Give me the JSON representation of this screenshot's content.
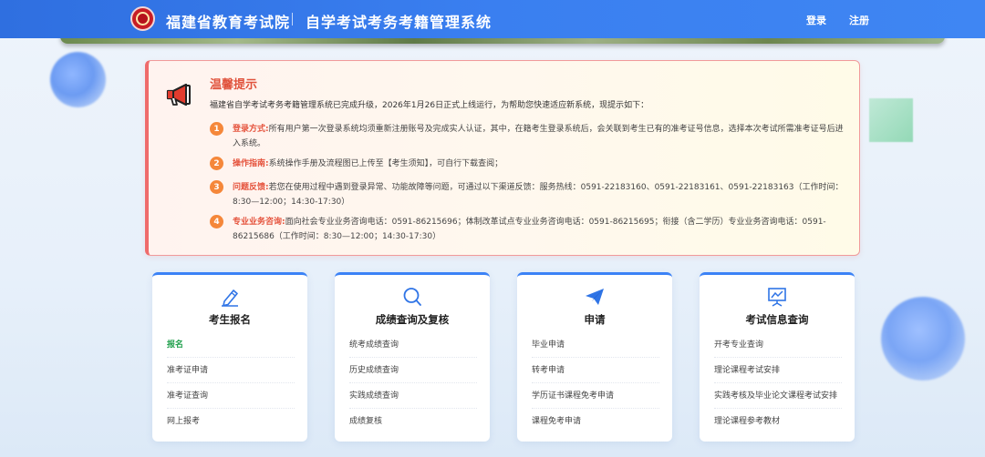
{
  "header": {
    "org_name": "福建省教育考试院",
    "system_name": "自学考试考务考籍管理系统",
    "login_label": "登录",
    "register_label": "注册"
  },
  "notice": {
    "title": "温馨提示",
    "intro": "福建省自学考试考务考籍管理系统已完成升级，2026年1月26日正式上线运行，为帮助您快速适应新系统，现提示如下：",
    "items": [
      {
        "num": "1",
        "label": "登录方式:",
        "text": "所有用户第一次登录系统均须重新注册账号及完成实人认证，其中，在籍考生登录系统后，会关联到考生已有的准考证号信息，选择本次考试所需准考证号后进入系统。"
      },
      {
        "num": "2",
        "label": "操作指南:",
        "text": "系统操作手册及流程图已上传至【考生须知】，可自行下载查阅；"
      },
      {
        "num": "3",
        "label": "问题反馈:",
        "text": "若您在使用过程中遇到登录异常、功能故障等问题，可通过以下渠道反馈：服务热线：0591-22183160、0591-22183161、0591-22183163（工作时间：8:30—12:00；14:30-17:30）"
      },
      {
        "num": "4",
        "label": "专业业务咨询:",
        "text": "面向社会专业业务咨询电话：0591-86215696；体制改革试点专业业务咨询电话：0591-86215695；衔接（含二学历）专业业务咨询电话：0591-86215686（工作时间：8:30—12:00；14:30-17:30）"
      }
    ]
  },
  "cards": [
    {
      "icon": "pencil-icon",
      "title": "考生报名",
      "links": [
        "报名",
        "准考证申请",
        "准考证查询",
        "网上报考"
      ]
    },
    {
      "icon": "search-icon",
      "title": "成绩查询及复核",
      "links": [
        "统考成绩查询",
        "历史成绩查询",
        "实践成绩查询",
        "成绩复核"
      ]
    },
    {
      "icon": "paper-plane-icon",
      "title": "申请",
      "links": [
        "毕业申请",
        "转考申请",
        "学历证书课程免考申请",
        "课程免考申请"
      ]
    },
    {
      "icon": "chart-board-icon",
      "title": "考试信息查询",
      "links": [
        "开考专业查询",
        "理论课程考试安排",
        "实践考核及毕业论文课程考试安排",
        "理论课程参考教材"
      ]
    }
  ],
  "colors": {
    "header_blue": "#3a7ff0",
    "notice_red": "#e0523c",
    "badge_orange": "#f5873a",
    "active_green": "#1f9f4b"
  }
}
